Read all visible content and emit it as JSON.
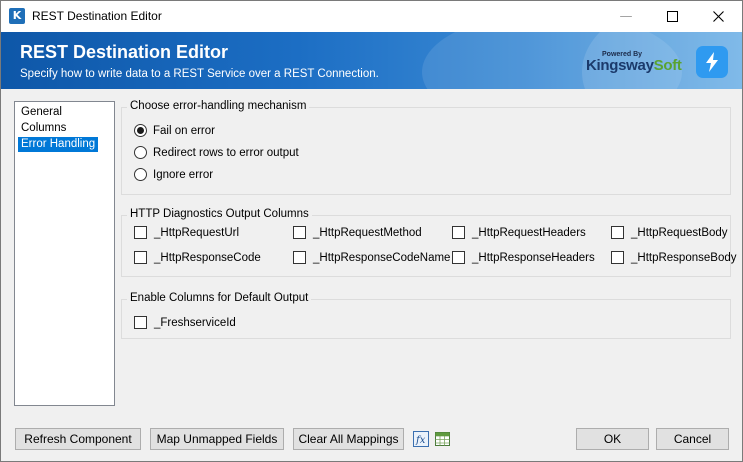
{
  "window": {
    "title": "REST Destination Editor",
    "app_icon_letter": "K"
  },
  "banner": {
    "title": "REST Destination Editor",
    "subtitle": "Specify how to write data to a REST Service over a REST Connection.",
    "brand_powered": "Powered By",
    "brand_name_part1": "Kingsway",
    "brand_name_part2": "Soft"
  },
  "nav": {
    "items": [
      "General",
      "Columns",
      "Error Handling"
    ],
    "selected": "Error Handling"
  },
  "error_handling": {
    "group_label": "Choose error-handling mechanism",
    "options": [
      "Fail on error",
      "Redirect rows to error output",
      "Ignore error"
    ],
    "selected": "Fail on error"
  },
  "diagnostics": {
    "group_label": "HTTP Diagnostics Output Columns",
    "columns": [
      "_HttpRequestUrl",
      "_HttpRequestMethod",
      "_HttpRequestHeaders",
      "_HttpRequestBody",
      "_HttpResponseCode",
      "_HttpResponseCodeName",
      "_HttpResponseHeaders",
      "_HttpResponseBody"
    ]
  },
  "default_output": {
    "group_label": "Enable Columns for Default Output",
    "columns": [
      "_FreshserviceId"
    ]
  },
  "buttons": {
    "refresh": "Refresh Component",
    "map_unmapped": "Map Unmapped Fields",
    "clear_mappings": "Clear All Mappings",
    "ok": "OK",
    "cancel": "Cancel"
  },
  "icons": {
    "app": "kingswaysoft-app-icon",
    "minimize": "minimize-icon",
    "maximize": "maximize-icon",
    "close": "close-icon",
    "bolt": "lightning-bolt-icon",
    "expression": "fx-expression-icon",
    "spreadsheet": "spreadsheet-icon"
  },
  "colors": {
    "accent": "#0078d7",
    "banner": "#1c6ec4",
    "brand_green": "#5aa331",
    "brand_navy": "#1b3a6b"
  }
}
